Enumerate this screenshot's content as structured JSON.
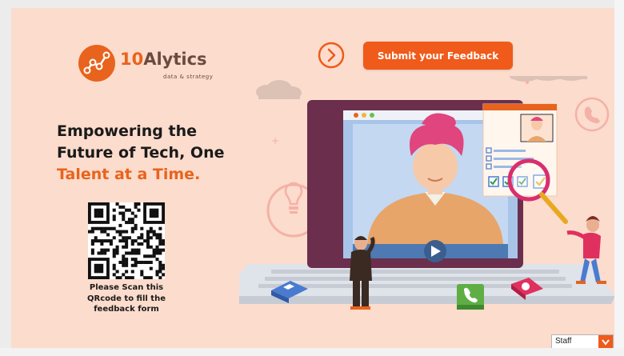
{
  "brand": {
    "name_prefix": "10",
    "name_rest": "Alytics",
    "tagline": "data & strategy"
  },
  "header": {
    "submit_label": "Submit your Feedback"
  },
  "headline": {
    "line1": "Empowering the",
    "line2": "Future of Tech, One",
    "line3": "Talent at a Time."
  },
  "qr": {
    "caption": "Please Scan this QRcode  to fill the feedback form"
  },
  "role_select": {
    "selected": "Staff"
  },
  "colors": {
    "accent": "#f05a1a",
    "background": "#fcdccc",
    "text": "#1a1a1a"
  },
  "icons": [
    "logo-network-icon",
    "arrow-right-circle-icon",
    "qr-code",
    "chevron-down-icon",
    "play-icon",
    "magnifier-icon",
    "checkbox-icon",
    "phone-icon",
    "lightbulb-icon"
  ]
}
